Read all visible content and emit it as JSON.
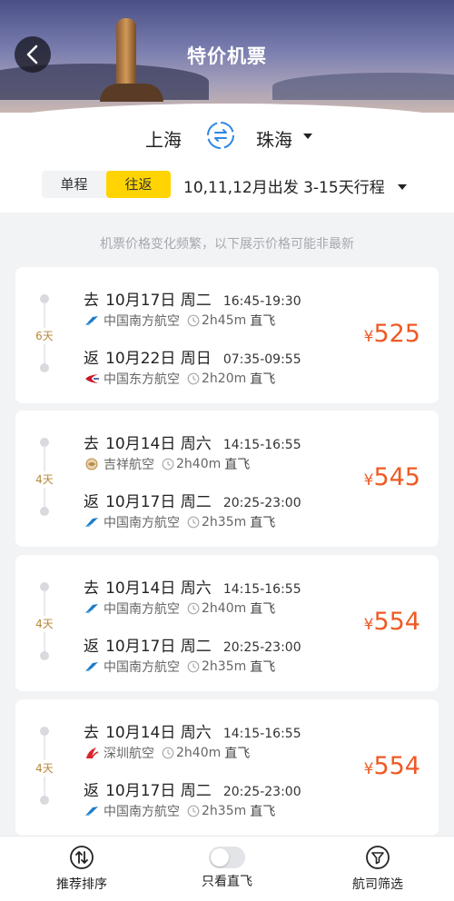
{
  "header": {
    "title": "特价机票"
  },
  "route": {
    "from": "上海",
    "to": "珠海"
  },
  "trip_type": {
    "one_way": "单程",
    "round_trip": "往返",
    "selected": "往返"
  },
  "date_range": "10,11,12月出发 3-15天行程",
  "notice": "机票价格变化频繁，以下展示价格可能非最新",
  "colors": {
    "accent": "#ffd400",
    "price": "#ee5a24",
    "days_label": "#b8873a"
  },
  "cards": [
    {
      "days": "6天",
      "price_symbol": "¥",
      "price": "525",
      "outbound": {
        "dir": "去",
        "date": "10月17日 周二",
        "time": "16:45-19:30",
        "airline": "中国南方航空",
        "airline_icon": "china-southern-icon",
        "duration": "2h45m",
        "type": "直飞"
      },
      "return": {
        "dir": "返",
        "date": "10月22日 周日",
        "time": "07:35-09:55",
        "airline": "中国东方航空",
        "airline_icon": "china-eastern-icon",
        "duration": "2h20m",
        "type": "直飞"
      }
    },
    {
      "days": "4天",
      "price_symbol": "¥",
      "price": "545",
      "outbound": {
        "dir": "去",
        "date": "10月14日 周六",
        "time": "14:15-16:55",
        "airline": "吉祥航空",
        "airline_icon": "juneyao-icon",
        "duration": "2h40m",
        "type": "直飞"
      },
      "return": {
        "dir": "返",
        "date": "10月17日 周二",
        "time": "20:25-23:00",
        "airline": "中国南方航空",
        "airline_icon": "china-southern-icon",
        "duration": "2h35m",
        "type": "直飞"
      }
    },
    {
      "days": "4天",
      "price_symbol": "¥",
      "price": "554",
      "outbound": {
        "dir": "去",
        "date": "10月14日 周六",
        "time": "14:15-16:55",
        "airline": "中国南方航空",
        "airline_icon": "china-southern-icon",
        "duration": "2h40m",
        "type": "直飞"
      },
      "return": {
        "dir": "返",
        "date": "10月17日 周二",
        "time": "20:25-23:00",
        "airline": "中国南方航空",
        "airline_icon": "china-southern-icon",
        "duration": "2h35m",
        "type": "直飞"
      }
    },
    {
      "days": "4天",
      "price_symbol": "¥",
      "price": "554",
      "outbound": {
        "dir": "去",
        "date": "10月14日 周六",
        "time": "14:15-16:55",
        "airline": "深圳航空",
        "airline_icon": "shenzhen-airlines-icon",
        "duration": "2h40m",
        "type": "直飞"
      },
      "return": {
        "dir": "返",
        "date": "10月17日 周二",
        "time": "20:25-23:00",
        "airline": "中国南方航空",
        "airline_icon": "china-southern-icon",
        "duration": "2h35m",
        "type": "直飞"
      }
    }
  ],
  "bottom_bar": {
    "sort": "推荐排序",
    "direct_only": "只看直飞",
    "direct_only_on": false,
    "filter": "航司筛选"
  }
}
